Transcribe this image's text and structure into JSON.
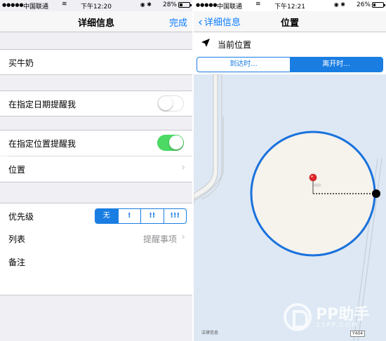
{
  "left": {
    "status": {
      "carrier": "中国联通",
      "time": "下午12:20",
      "battery": "28%",
      "battery_level": 0.28
    },
    "nav": {
      "title": "详细信息",
      "done": "完成"
    },
    "item_title": "买牛奶",
    "remind_date_label": "在指定日期提醒我",
    "remind_date_on": false,
    "remind_location_label": "在指定位置提醒我",
    "remind_location_on": true,
    "location_label": "位置",
    "priority_label": "优先级",
    "priority_options": [
      "无",
      "!",
      "!!",
      "!!!"
    ],
    "priority_selected": "无",
    "list_label": "列表",
    "list_value": "提醒事项",
    "notes_label": "备注"
  },
  "right": {
    "status": {
      "carrier": "中国联通",
      "time": "下午12:21",
      "battery": "26%",
      "battery_level": 0.26
    },
    "nav": {
      "back_label": "详细信息",
      "title": "位置"
    },
    "current_location": "当前位置",
    "when_options": [
      "到达时...",
      "离开时..."
    ],
    "when_selected": "离开时...",
    "map_legal": "法律信息",
    "map_mark": "Y404"
  },
  "watermark": {
    "brand": "PP助手",
    "sub": "25PP.COM"
  },
  "colors": {
    "accent": "#0a7cff",
    "toggle_on": "#4cd964",
    "geofence": "#1a72dd",
    "pin": "#e2262a",
    "map_bg": "#dde8f4"
  },
  "icons": [
    "wifi-icon",
    "bluetooth-icon",
    "location-arrow-icon",
    "chevron-right-icon",
    "chevron-left-icon",
    "map-pin-icon"
  ]
}
